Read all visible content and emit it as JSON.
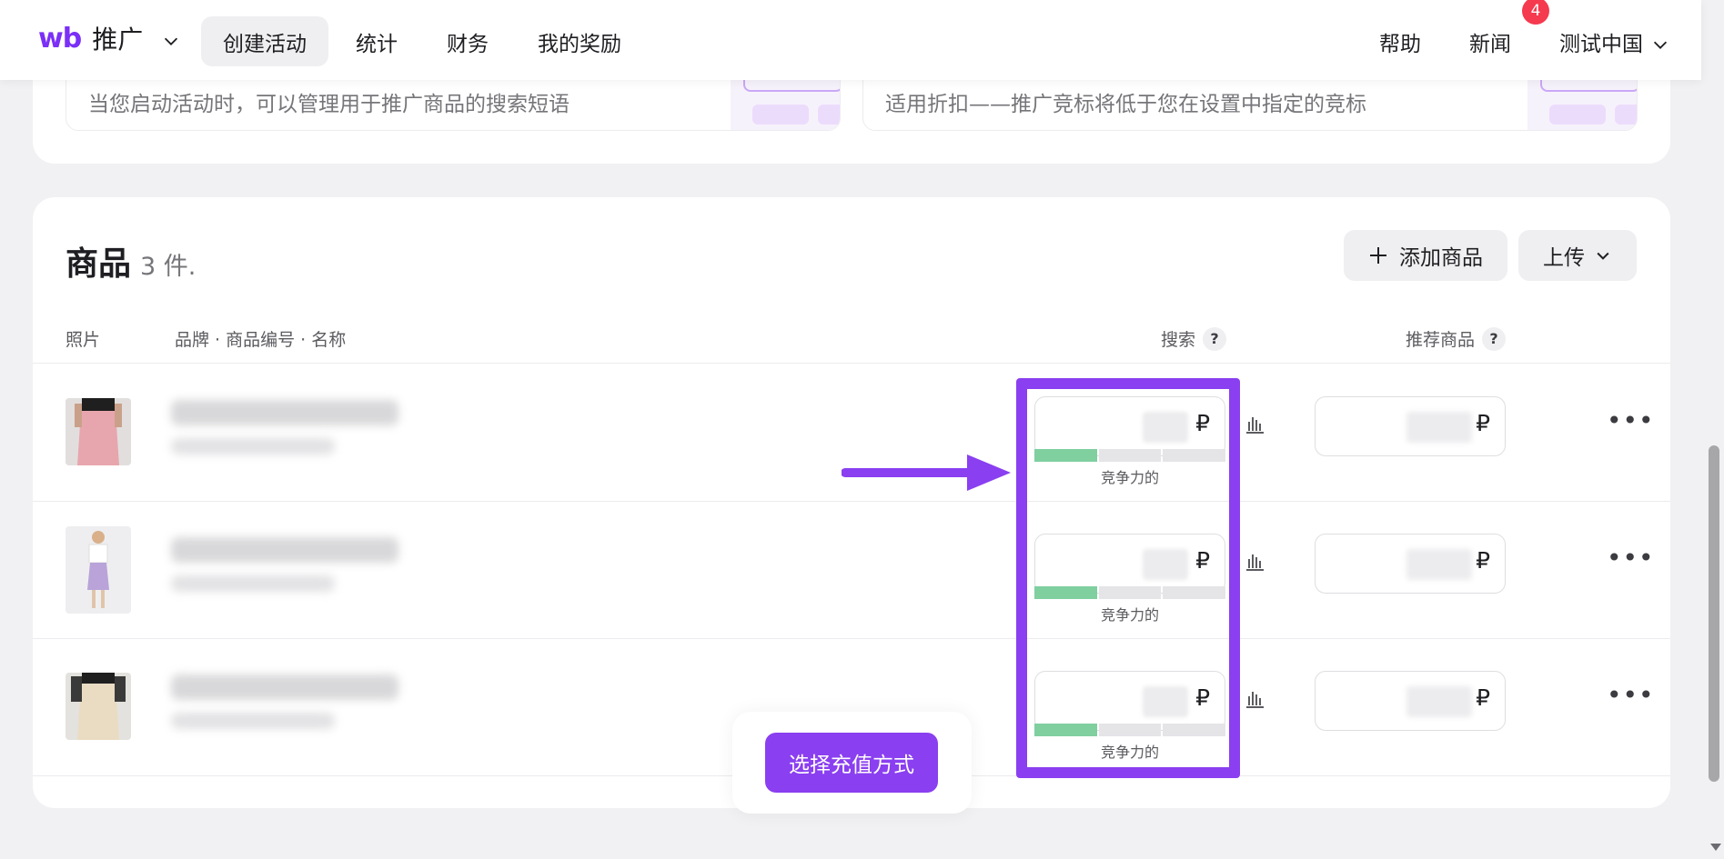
{
  "header": {
    "logo_mark": "wb",
    "logo_text": "推广",
    "nav": [
      "创建活动",
      "统计",
      "财务",
      "我的奖励"
    ],
    "help": "帮助",
    "news": "新闻",
    "news_badge": "4",
    "user": "测试中国"
  },
  "tips": [
    {
      "text": "当您启动活动时，可以管理用于推广商品的搜索短语"
    },
    {
      "text": "适用折扣——推广竞标将低于您在设置中指定的竞标"
    }
  ],
  "products": {
    "title": "商品",
    "count": "3 件.",
    "add_button": "添加商品",
    "upload_button": "上传",
    "columns": {
      "photo": "照片",
      "name": "品牌 · 商品编号 · 名称",
      "search": "搜索",
      "recommend": "推荐商品",
      "help_mark": "?"
    },
    "currency": "₽",
    "rows": [
      {
        "competitive_label": "竞争力的",
        "competitiveness_level": 0.33
      },
      {
        "competitive_label": "竞争力的",
        "competitiveness_level": 0.33
      },
      {
        "competitive_label": "竞争力的",
        "competitiveness_level": 0.33
      }
    ]
  },
  "pay_button": "选择充值方式",
  "colors": {
    "accent": "#8a3ff0",
    "brand": "#7b2ff7",
    "badge": "#f5394e",
    "competitive_green": "#7fcf9f"
  }
}
